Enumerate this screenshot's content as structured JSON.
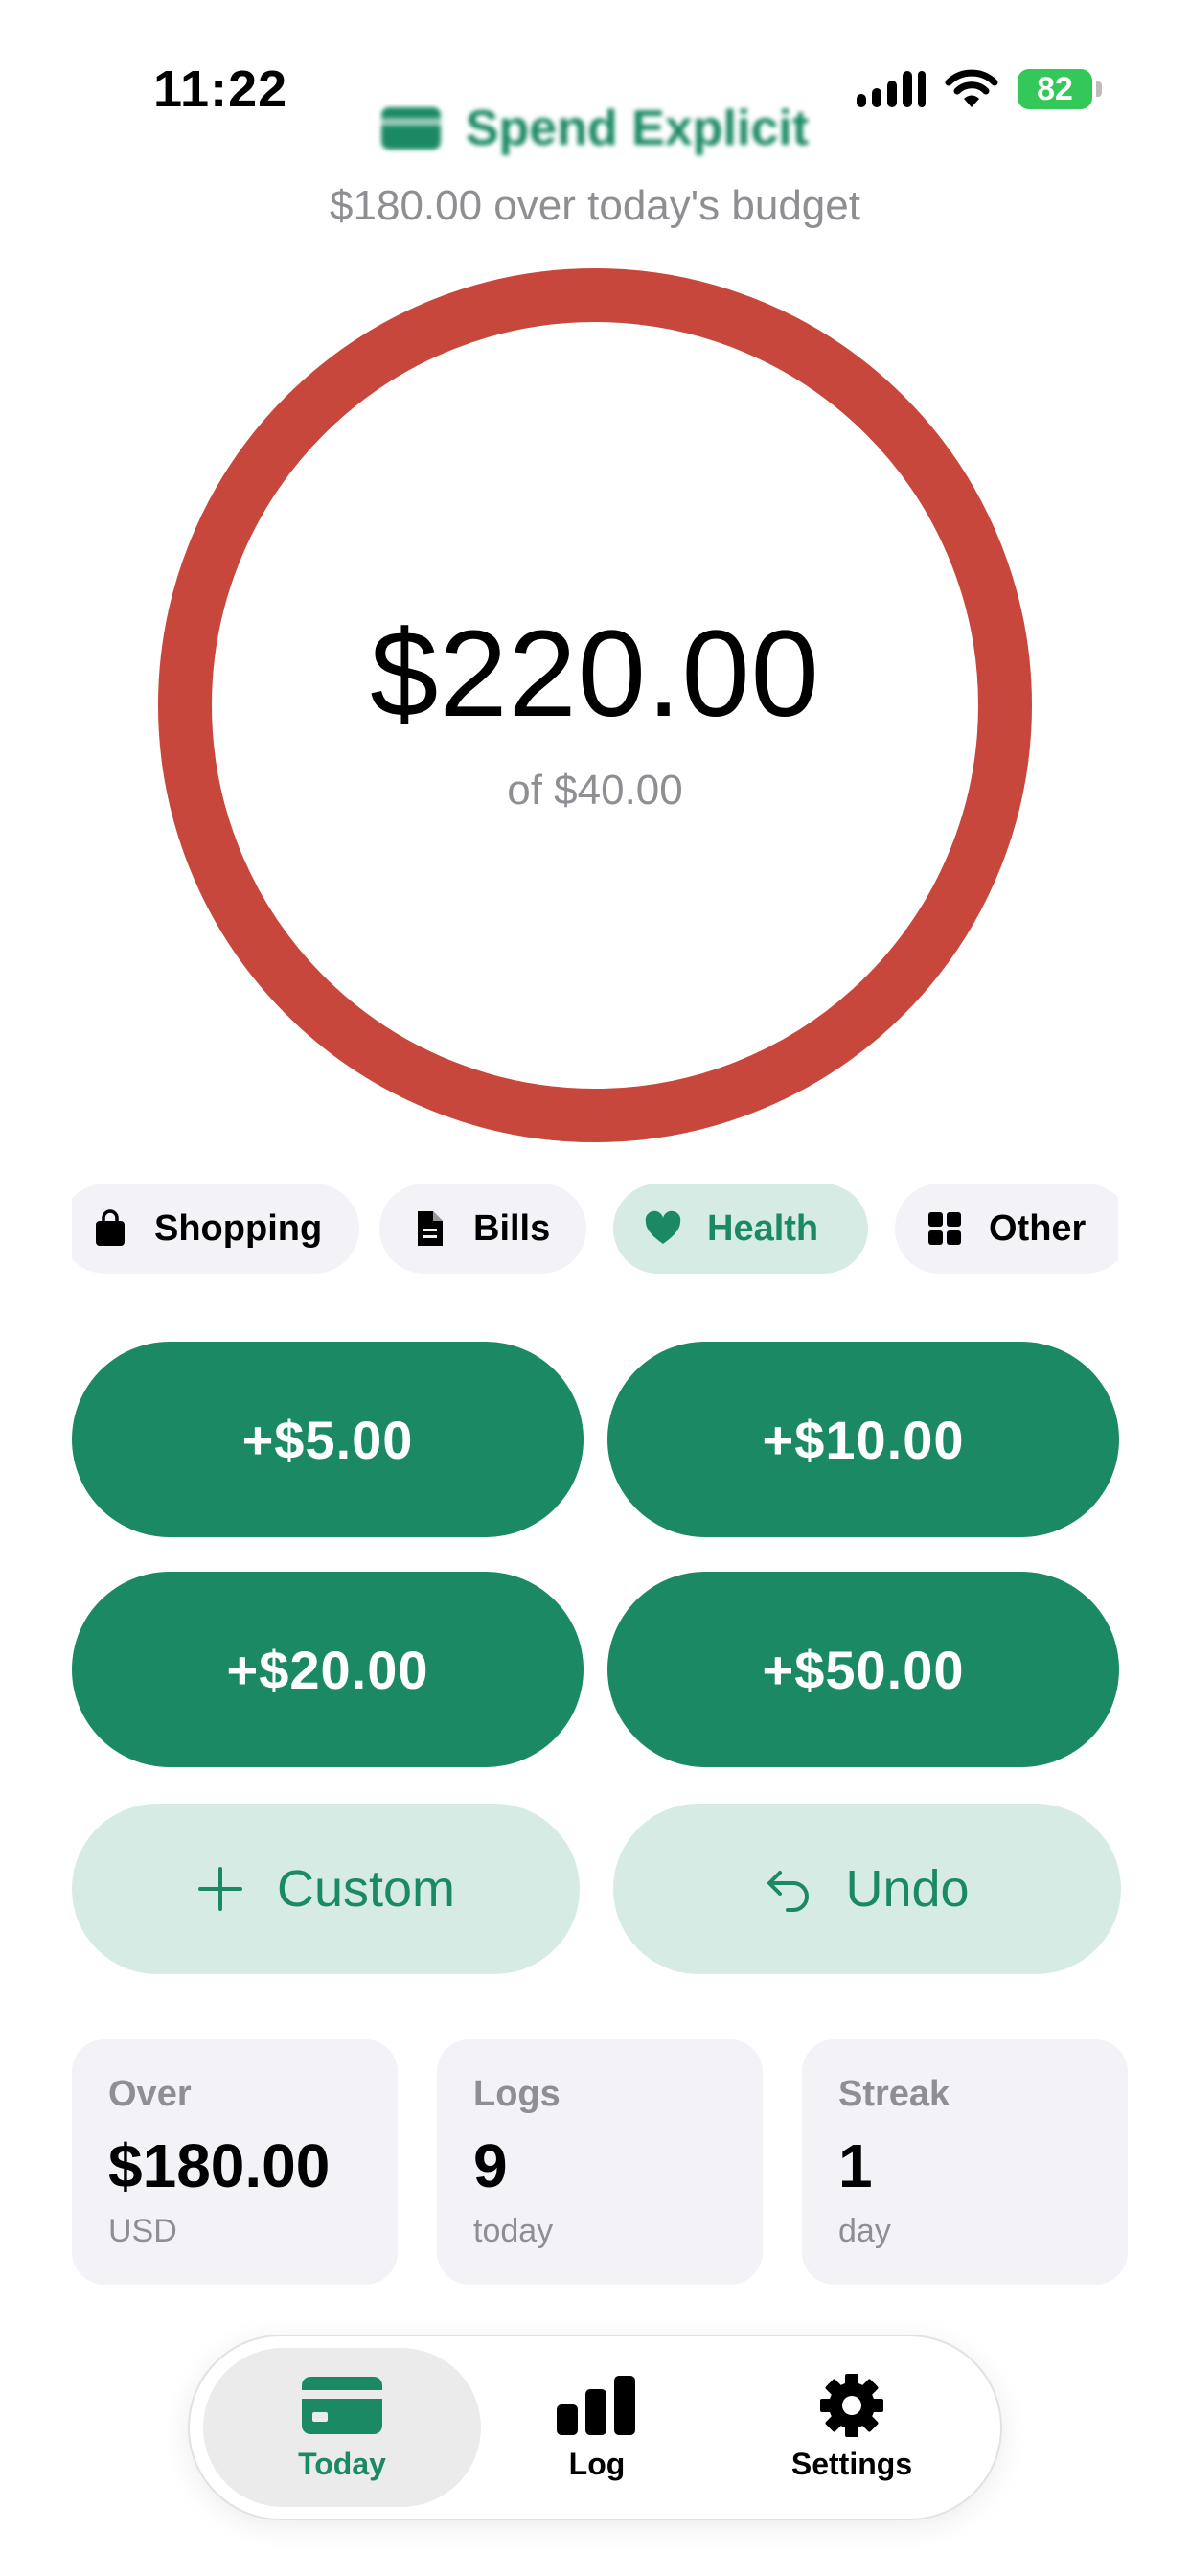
{
  "status_bar": {
    "time": "11:22",
    "battery": "82"
  },
  "app": {
    "title": "Spend Explicit"
  },
  "summary": {
    "status_text": "$180.00 over today's budget",
    "spent": "$220.00",
    "of_budget": "of $40.00",
    "budget_progress": 5.5
  },
  "categories": [
    {
      "label": "Shopping",
      "icon": "shopping-bag-icon",
      "selected": false
    },
    {
      "label": "Bills",
      "icon": "document-icon",
      "selected": false
    },
    {
      "label": "Health",
      "icon": "heart-icon",
      "selected": true
    },
    {
      "label": "Other",
      "icon": "grid-icon",
      "selected": false
    }
  ],
  "quick_amounts": [
    "+$5.00",
    "+$10.00",
    "+$20.00",
    "+$50.00"
  ],
  "actions": {
    "custom": "Custom",
    "undo": "Undo"
  },
  "stats": [
    {
      "label": "Over",
      "value": "$180.00",
      "sub": "USD"
    },
    {
      "label": "Logs",
      "value": "9",
      "sub": "today"
    },
    {
      "label": "Streak",
      "value": "1",
      "sub": "day"
    }
  ],
  "tabs": [
    {
      "label": "Today",
      "icon": "card-icon",
      "active": true
    },
    {
      "label": "Log",
      "icon": "bar-chart-icon",
      "active": false
    },
    {
      "label": "Settings",
      "icon": "gear-icon",
      "active": false
    }
  ],
  "colors": {
    "accent": "#1b8a64",
    "accent_soft": "#d5ebe3",
    "over_budget": "#c8473c",
    "battery": "#34c759",
    "muted_text": "#8e8e93"
  }
}
